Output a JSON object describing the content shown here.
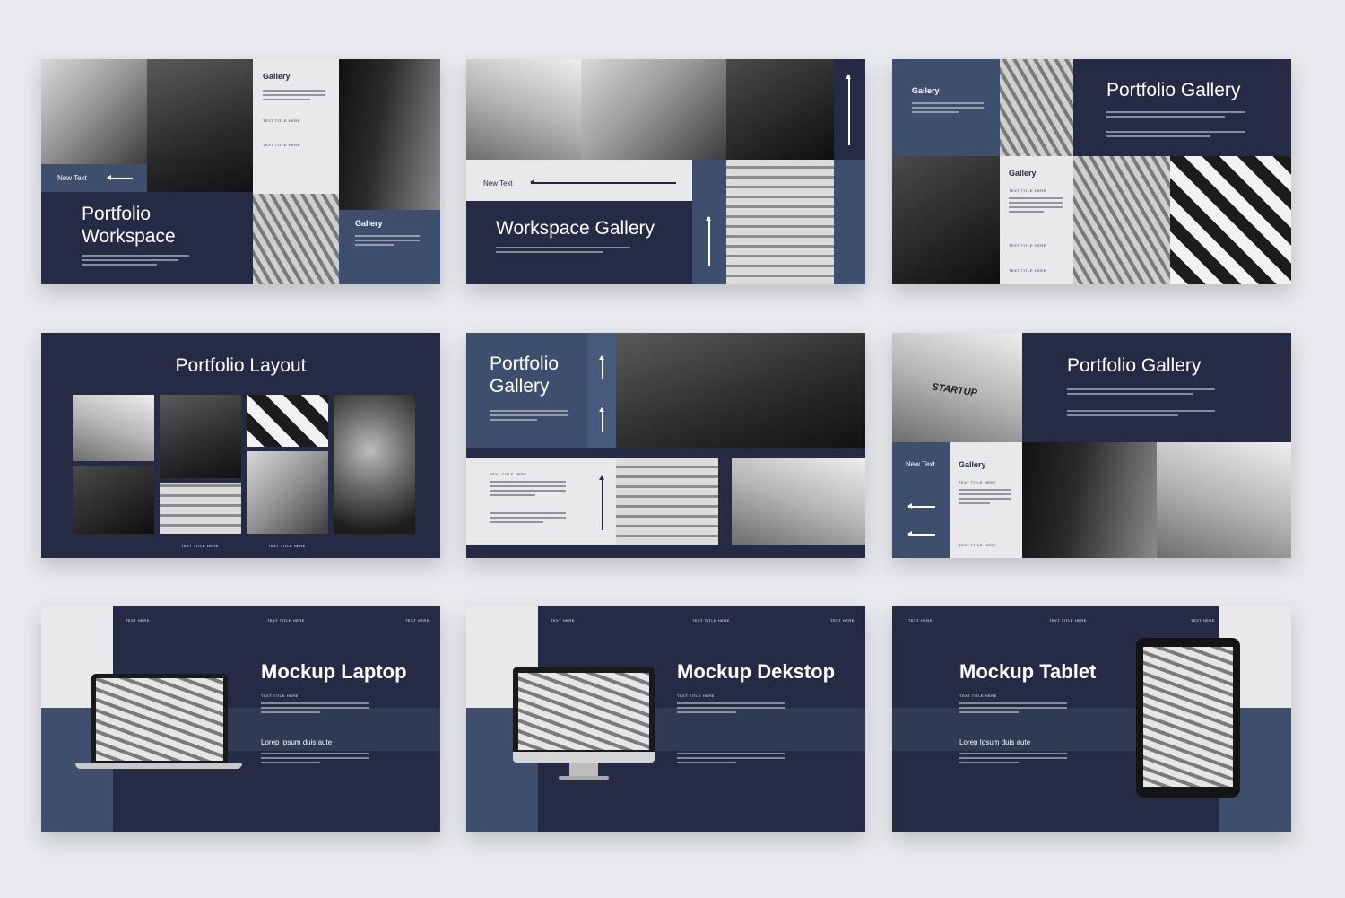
{
  "slides": {
    "s1": {
      "label": "New Text",
      "title_line1": "Portfolio",
      "title_line2": "Workspace",
      "gallery_a": "Gallery",
      "gallery_b": "Gallery",
      "tag_a": "TEXT TITLE HERE",
      "tag_b": "TEXT TITLE HERE"
    },
    "s2": {
      "label": "New Text",
      "title": "Workspace Gallery"
    },
    "s3": {
      "title": "Portfolio Gallery",
      "gallery_a": "Gallery",
      "gallery_b": "Gallery",
      "tag_a": "TEXT TITLE HERE",
      "tag_b": "TEXT TITLE HERE",
      "tag_c": "TEXT TITLE HERE"
    },
    "s4": {
      "title": "Portfolio Layout",
      "tag_a": "TEXT TITLE HERE",
      "tag_b": "TEXT TITLE HERE"
    },
    "s5": {
      "title_line1": "Portfolio",
      "title_line2": "Gallery",
      "tag_a": "TEXT TITLE HERE"
    },
    "s6": {
      "title": "Portfolio Gallery",
      "label": "New Text",
      "gallery": "Gallery",
      "sign": "STARTUP",
      "tag_a": "TEXT TITLE HERE",
      "tag_b": "TEXT TITLE HERE"
    },
    "s7": {
      "title": "Mockup Laptop",
      "header_left": "TEXT HERE",
      "header_mid": "TEXT TITLE HERE",
      "header_right": "TEXT HERE",
      "sub_tag": "TEXT TITLE HERE",
      "subheading": "Lorep Ipsum duis aute"
    },
    "s8": {
      "title": "Mockup Dekstop",
      "header_left": "TEXT HERE",
      "header_mid": "TEXT TITLE HERE",
      "header_right": "TEXT HERE",
      "sub_tag": "TEXT TITLE HERE"
    },
    "s9": {
      "title": "Mockup Tablet",
      "header_left": "TEXT HERE",
      "header_mid": "TEXT TITLE HERE",
      "header_right": "TEXT HERE",
      "sub_tag": "TEXT TITLE HERE",
      "subheading": "Lorep Ipsum duis aute"
    }
  },
  "colors": {
    "navy": "#252b45",
    "steel": "#3e4e6d",
    "light": "#e9e9ec",
    "background": "#e9eaed"
  }
}
